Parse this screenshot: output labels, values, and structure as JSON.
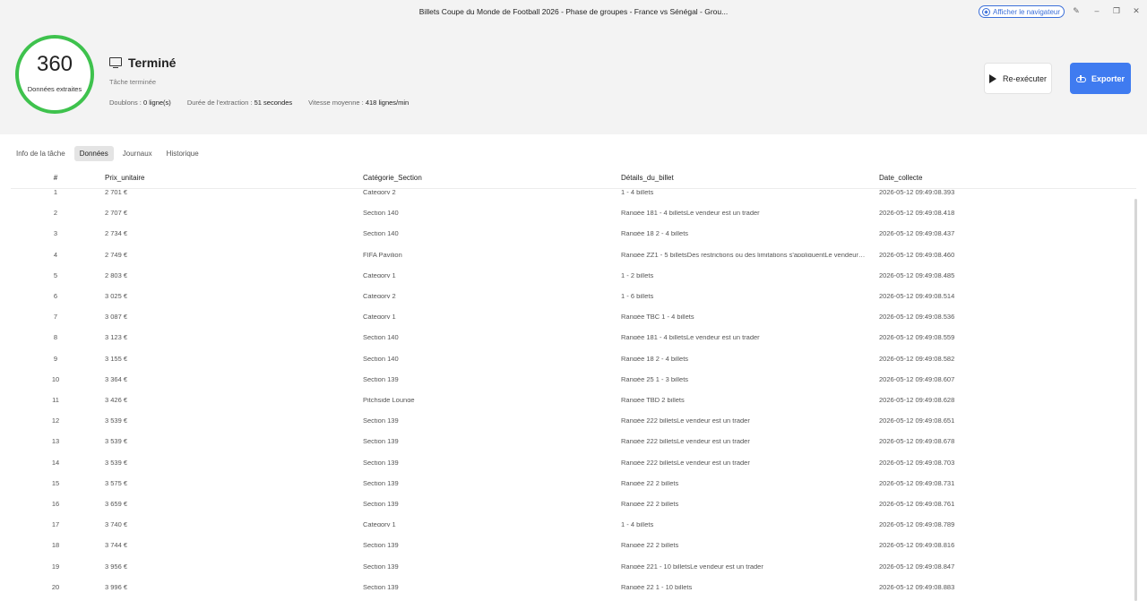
{
  "window": {
    "title": "Billets Coupe du Monde de Football 2026 - Phase de groupes - France vs Sénégal - Grou...",
    "browser_button": "Afficher le navigateur"
  },
  "summary": {
    "count": "360",
    "count_label": "Données extraites",
    "state": "Terminé",
    "substate": "Tâche terminée",
    "duplicates_label": "Doublons :",
    "duplicates_value": "0 ligne(s)",
    "duration_label": "Durée de l'extraction :",
    "duration_value": "51 secondes",
    "speed_label": "Vitesse moyenne :",
    "speed_value": "418 lignes/min",
    "ring_color": "#3ec24d"
  },
  "actions": {
    "rerun": "Re-exécuter",
    "export": "Exporter",
    "export_color": "#3f7bf0"
  },
  "tabs": [
    "Info de la tâche",
    "Données",
    "Journaux",
    "Historique"
  ],
  "active_tab": "Données",
  "table": {
    "columns": [
      "#",
      "Prix_unitaire",
      "Catégorie_Section",
      "Détails_du_billet",
      "Date_collecte"
    ],
    "rows": [
      [
        "1",
        "2 701 €",
        "Category 2",
        "1 - 4 billets",
        "2026-05-12 09:49:08.393"
      ],
      [
        "2",
        "2 707 €",
        "Section 140",
        "Rangée 181 - 4 billetsLe vendeur est un trader",
        "2026-05-12 09:49:08.418"
      ],
      [
        "3",
        "2 734 €",
        "Section 140",
        "Rangée 18 2 - 4 billets",
        "2026-05-12 09:49:08.437"
      ],
      [
        "4",
        "2 749 €",
        "FIFA Pavilion",
        "Rangée ZZ1 - 5 billetsDes restrictions ou des limitations s'appliquentLe vendeur est un trader",
        "2026-05-12 09:49:08.460"
      ],
      [
        "5",
        "2 803 €",
        "Category 1",
        "1 - 2 billets",
        "2026-05-12 09:49:08.485"
      ],
      [
        "6",
        "3 025 €",
        "Category 2",
        "1 - 6 billets",
        "2026-05-12 09:49:08.514"
      ],
      [
        "7",
        "3 087 €",
        "Category 1",
        "Rangée TBC 1 - 4 billets",
        "2026-05-12 09:49:08.536"
      ],
      [
        "8",
        "3 123 €",
        "Section 140",
        "Rangée 181 - 4 billetsLe vendeur est un trader",
        "2026-05-12 09:49:08.559"
      ],
      [
        "9",
        "3 155 €",
        "Section 140",
        "Rangée 18 2 - 4 billets",
        "2026-05-12 09:49:08.582"
      ],
      [
        "10",
        "3 364 €",
        "Section 139",
        "Rangée 25 1 - 3 billets",
        "2026-05-12 09:49:08.607"
      ],
      [
        "11",
        "3 426 €",
        "Pitchside Lounge",
        "Rangée TBD 2 billets",
        "2026-05-12 09:49:08.628"
      ],
      [
        "12",
        "3 539 €",
        "Section 139",
        "Rangée 222 billetsLe vendeur est un trader",
        "2026-05-12 09:49:08.651"
      ],
      [
        "13",
        "3 539 €",
        "Section 139",
        "Rangée 222 billetsLe vendeur est un trader",
        "2026-05-12 09:49:08.678"
      ],
      [
        "14",
        "3 539 €",
        "Section 139",
        "Rangée 222 billetsLe vendeur est un trader",
        "2026-05-12 09:49:08.703"
      ],
      [
        "15",
        "3 575 €",
        "Section 139",
        "Rangée 22 2 billets",
        "2026-05-12 09:49:08.731"
      ],
      [
        "16",
        "3 659 €",
        "Section 139",
        "Rangée 22 2 billets",
        "2026-05-12 09:49:08.761"
      ],
      [
        "17",
        "3 740 €",
        "Category 1",
        "1 - 4 billets",
        "2026-05-12 09:49:08.789"
      ],
      [
        "18",
        "3 744 €",
        "Section 139",
        "Rangée 22 2 billets",
        "2026-05-12 09:49:08.816"
      ],
      [
        "19",
        "3 956 €",
        "Section 139",
        "Rangée 221 - 10 billetsLe vendeur est un trader",
        "2026-05-12 09:49:08.847"
      ],
      [
        "20",
        "3 996 €",
        "Section 139",
        "Rangée 22 1 - 10 billets",
        "2026-05-12 09:49:08.883"
      ]
    ]
  }
}
